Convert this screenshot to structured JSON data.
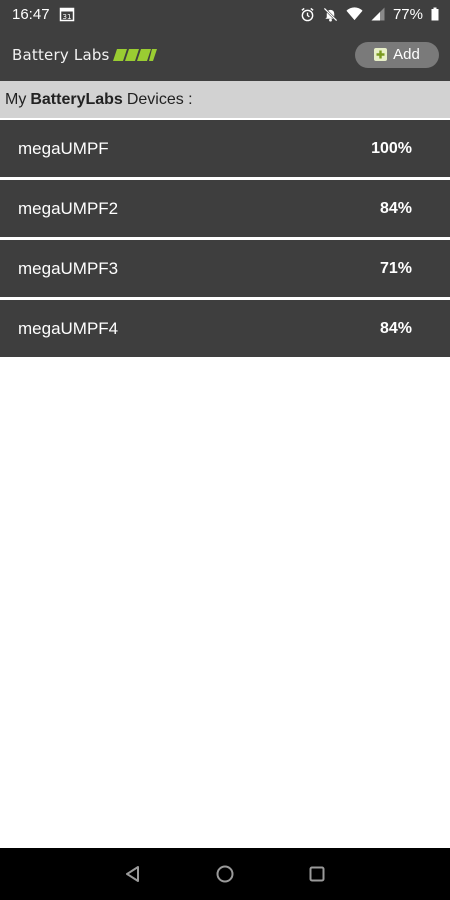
{
  "status_bar": {
    "time": "16:47",
    "calendar_date": "31",
    "battery_percent": "77%",
    "icons": [
      "calendar-icon",
      "alarm-icon",
      "mute-notifications-icon",
      "wifi-icon",
      "signal-icon",
      "battery-icon"
    ]
  },
  "app": {
    "brand_name": "Battery Labs",
    "brand_accent_color": "#9acd32",
    "add_label": "Add"
  },
  "devices_heading": {
    "prefix": "My",
    "brand": "BatteryLabs",
    "suffix": "Devices :"
  },
  "devices": [
    {
      "name": "megaUMPF",
      "level": "100%"
    },
    {
      "name": "megaUMPF2",
      "level": "84%"
    },
    {
      "name": "megaUMPF3",
      "level": "71%"
    },
    {
      "name": "megaUMPF4",
      "level": "84%"
    }
  ],
  "nav": [
    "back-icon",
    "home-icon",
    "recents-icon"
  ]
}
